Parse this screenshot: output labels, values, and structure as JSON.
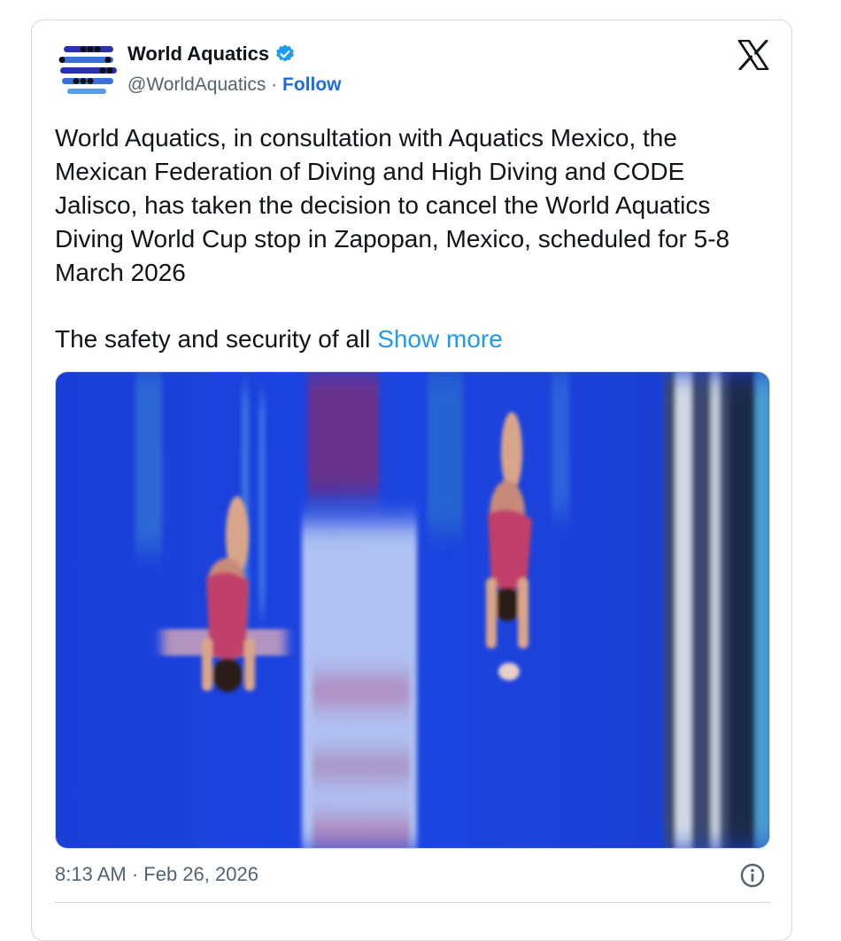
{
  "tweet": {
    "author_name": "World Aquatics",
    "handle": "@WorldAquatics",
    "separator": "·",
    "follow_label": "Follow",
    "body_paragraph_1": "World Aquatics, in consultation with Aquatics Mexico, the Mexican Federation of Diving and High Diving and CODE Jalisco, has taken the decision to cancel the World Aquatics Diving World Cup stop in Zapopan, Mexico, scheduled for 5-8 March 2026",
    "body_paragraph_2": "The safety and security of all",
    "show_more_label": "Show more",
    "timestamp": "8:13 AM · Feb 26, 2026"
  },
  "icons": {
    "avatar": "world-aquatics-logo",
    "verified": "verified-badge-icon",
    "platform": "x-logo-icon",
    "info": "info-icon"
  },
  "colors": {
    "link": "#1d9bf0",
    "follow": "#1d6fd6",
    "verified": "#1d9bf0",
    "text": "#0f1419",
    "secondary_text": "#536471",
    "border": "#cfd9de",
    "image_background": "#1a3fd8"
  }
}
